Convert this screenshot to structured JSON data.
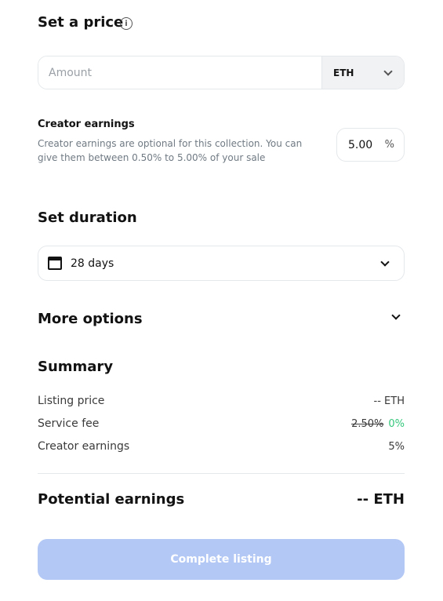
{
  "price": {
    "title": "Set a price",
    "info_icon": "i",
    "amount_placeholder": "Amount",
    "currency": "ETH"
  },
  "creator": {
    "title": "Creator earnings",
    "description_line1": "Creator earnings are optional for this collection. You can",
    "description_line2": "give them between 0.50% to 5.00% of your sale",
    "value": "5.00",
    "unit": "%"
  },
  "duration": {
    "title": "Set duration",
    "value": "28 days"
  },
  "more_options": {
    "title": "More options"
  },
  "summary": {
    "title": "Summary",
    "rows": [
      {
        "label": "Listing price",
        "value": "-- ETH"
      },
      {
        "label": "Service fee",
        "old_value": "2.50%",
        "value": "0%"
      },
      {
        "label": "Creator earnings",
        "value": "5%"
      }
    ],
    "potential_label": "Potential earnings",
    "potential_value": "-- ETH"
  },
  "action": {
    "complete_label": "Complete listing"
  },
  "colors": {
    "accent_disabled": "#b3c8f5",
    "positive": "#34c77b"
  }
}
